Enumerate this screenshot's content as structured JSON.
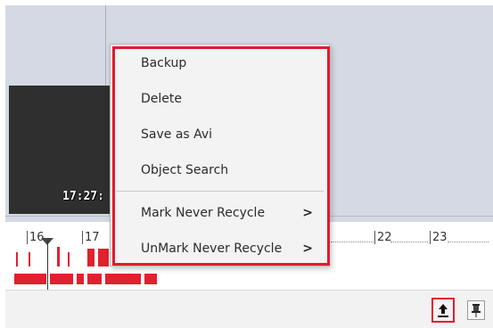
{
  "video": {
    "timestamp": "17:27:"
  },
  "timeline": {
    "labels": [
      "16",
      "17",
      "22",
      "23"
    ]
  },
  "context_menu": {
    "items": [
      {
        "label": "Backup"
      },
      {
        "label": "Delete"
      },
      {
        "label": "Save as Avi"
      },
      {
        "label": "Object Search"
      },
      {
        "label": "Mark Never Recycle",
        "submenu_arrow": ">"
      },
      {
        "label": "UnMark Never Recycle",
        "submenu_arrow": ">"
      }
    ]
  },
  "icons": {
    "upload": "upload-icon",
    "pin": "pin-icon"
  },
  "colors": {
    "highlight": "#e31a2d",
    "recording": "#e0212e",
    "viewport_bg": "#d4d9e3"
  }
}
